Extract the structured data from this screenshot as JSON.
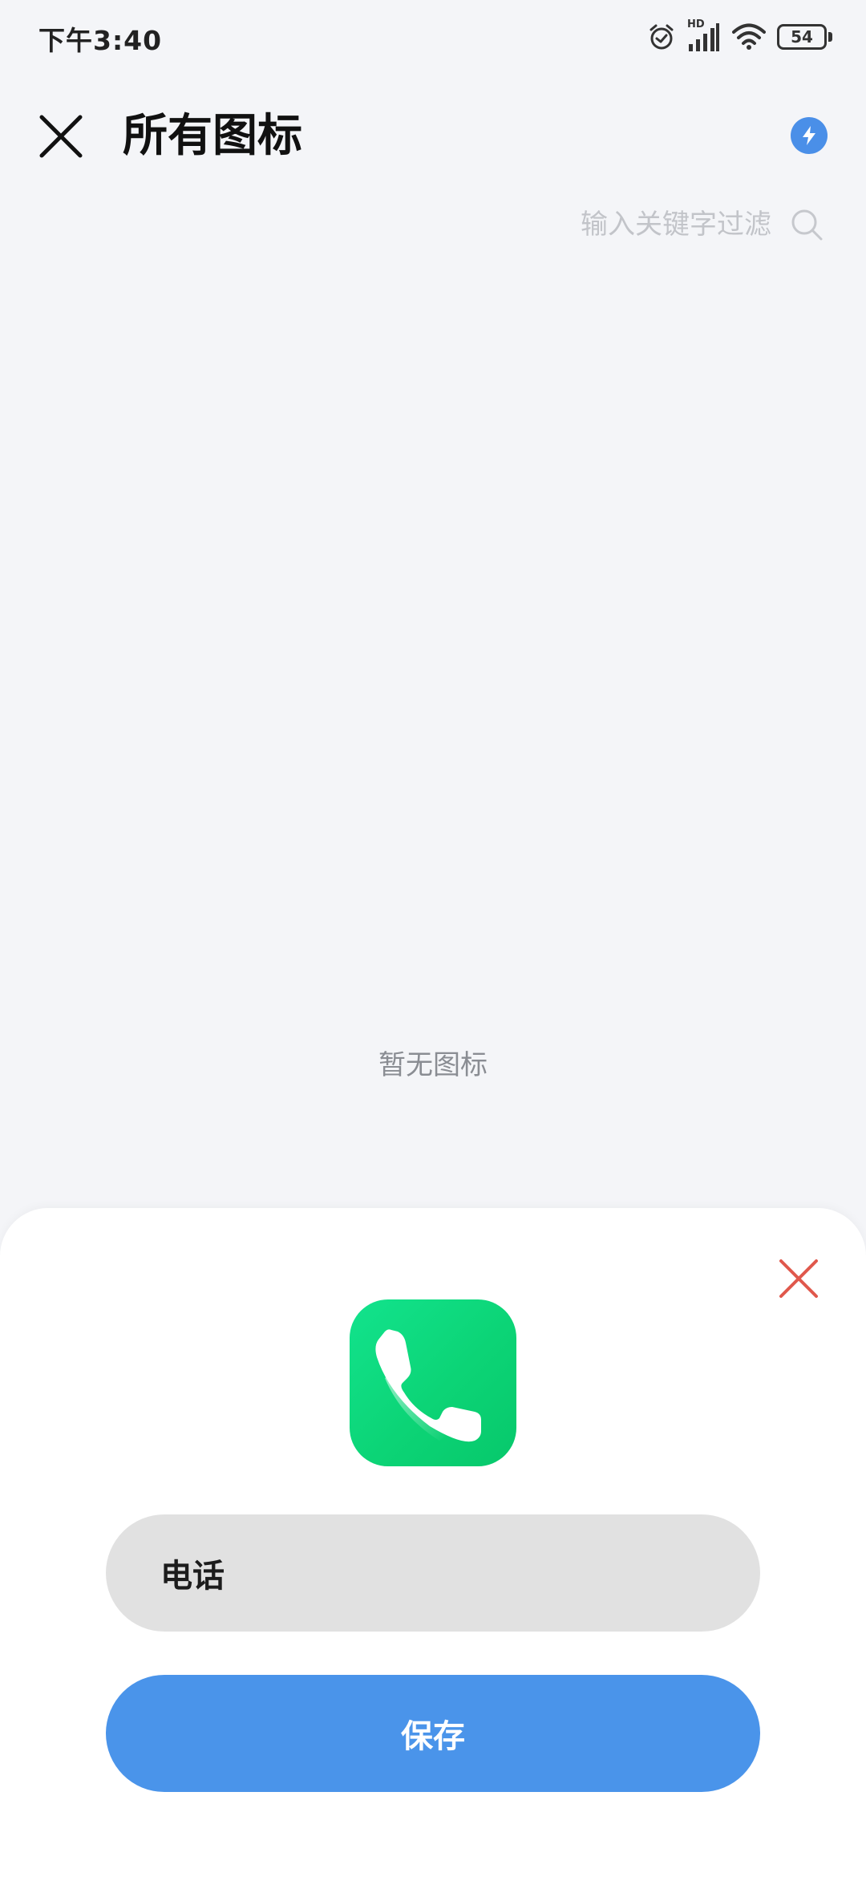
{
  "status_bar": {
    "time": "下午3:40",
    "network_label": "HD",
    "battery_level": "54",
    "icons": [
      "alarm-icon",
      "signal-icon",
      "wifi-icon",
      "battery-icon"
    ]
  },
  "header": {
    "title": "所有图标",
    "close_icon": "close-icon",
    "action_icon": "flash-icon"
  },
  "search": {
    "placeholder": "输入关键字过滤",
    "value": "",
    "icon": "search-icon"
  },
  "empty_state": {
    "message": "暂无图标"
  },
  "sheet": {
    "close_icon": "close-icon",
    "app_icon": "phone-icon",
    "name_value": "电话",
    "save_label": "保存"
  },
  "colors": {
    "background": "#f4f5f8",
    "accent": "#4a94ea",
    "sheet_close": "#e0584c",
    "icon_green": "#0cd476",
    "field_bg": "#e1e1e1"
  }
}
